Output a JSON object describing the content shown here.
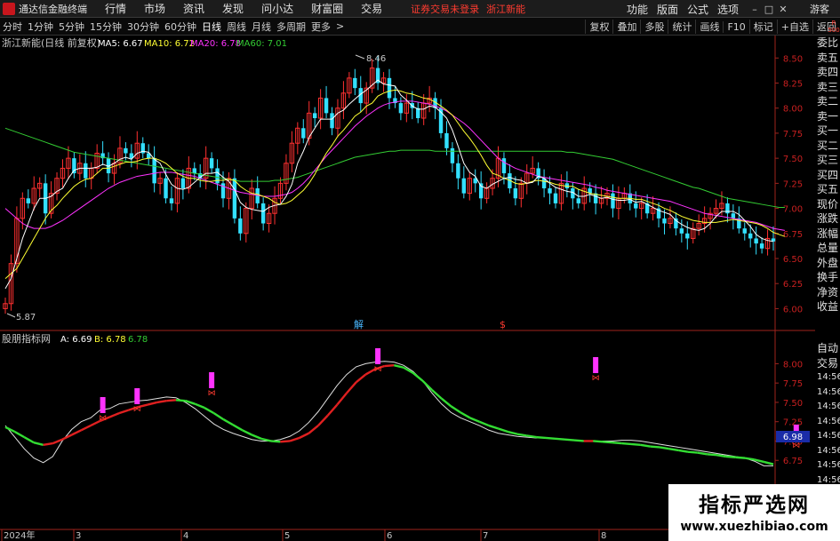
{
  "app": {
    "name": "通达信金融终端",
    "menus": [
      "行情",
      "市场",
      "资讯",
      "发现",
      "问小达",
      "财富圈",
      "交易"
    ],
    "status_text": "证券交易未登录",
    "stock_short": "浙江新能",
    "right_menus": [
      "功能",
      "版面",
      "公式",
      "选项"
    ],
    "guest": "游客"
  },
  "toolbar": {
    "periods": [
      "分时",
      "1分钟",
      "5分钟",
      "15分钟",
      "30分钟",
      "60分钟",
      "日线",
      "周线",
      "月线",
      "多周期",
      "更多"
    ],
    "active_period": "日线",
    "more_arrow": ">",
    "buttons": [
      "复权",
      "叠加",
      "多股",
      "统计",
      "画线",
      "F10",
      "标记",
      "+自选",
      "返回"
    ],
    "sell_badge": "R 500"
  },
  "main_header": {
    "title": "浙江新能(日线 前复权)",
    "ma_items": [
      {
        "label": "MA5: 6.67",
        "color": "#ffffff"
      },
      {
        "label": "MA10: 6.72",
        "color": "#ffff33"
      },
      {
        "label": "MA20: 6.78",
        "color": "#ff33ff"
      },
      {
        "label": "MA60: 7.01",
        "color": "#33cc33"
      }
    ]
  },
  "sub_header": {
    "title": "股朋指标网",
    "items": [
      {
        "label": "A: 6.69",
        "color": "#ffffff"
      },
      {
        "label": "B: 6.78",
        "color": "#ffff33"
      },
      {
        "label": "6.78",
        "color": "#33cc33"
      }
    ]
  },
  "sidebar": {
    "top_items": [
      "委比",
      "卖五",
      "卖四",
      "卖三",
      "卖二",
      "卖一",
      "买一",
      "买二",
      "买三",
      "买四",
      "买五",
      "现价",
      "涨跌",
      "涨幅",
      "总量",
      "外盘",
      "换手",
      "净资",
      "收益"
    ],
    "bottom_items": [
      "自动",
      "交易"
    ],
    "times": [
      "14:56",
      "14:56",
      "14:56",
      "14:56",
      "14:56",
      "14:56",
      "14:56",
      "14:56"
    ]
  },
  "watermark": {
    "title": "指标严选网",
    "url": "www.xuezhibiao.com"
  },
  "chart_data": {
    "type": "candlestick",
    "main_panel": {
      "ylim": [
        5.8,
        8.6
      ],
      "y_ticks": [
        "8.50",
        "8.25",
        "8.00",
        "7.75",
        "7.50",
        "7.25",
        "7.00",
        "6.75",
        "6.50",
        "6.25",
        "6.00"
      ],
      "high_annotation": "8.46",
      "low_annotation": "5.87",
      "current_price": 6.67,
      "markers": [
        "解",
        "$"
      ],
      "closes": [
        6.05,
        6.45,
        6.9,
        7.1,
        7.05,
        7.2,
        7.25,
        6.95,
        7.15,
        7.3,
        7.4,
        7.5,
        7.35,
        7.45,
        7.3,
        7.4,
        7.55,
        7.5,
        7.35,
        7.45,
        7.6,
        7.55,
        7.5,
        7.65,
        7.55,
        7.5,
        7.25,
        7.3,
        7.1,
        7.05,
        7.3,
        7.2,
        7.4,
        7.35,
        7.3,
        7.5,
        7.4,
        7.25,
        7.1,
        7.3,
        6.9,
        6.75,
        7.0,
        7.2,
        7.05,
        6.85,
        6.95,
        7.1,
        7.25,
        7.45,
        7.65,
        7.8,
        7.7,
        7.95,
        7.9,
        8.1,
        7.95,
        7.8,
        8.0,
        8.15,
        8.3,
        8.2,
        8.05,
        8.2,
        8.4,
        8.25,
        8.3,
        8.1,
        8.05,
        7.95,
        8.05,
        8.0,
        7.9,
        8.05,
        8.1,
        8.0,
        7.75,
        7.6,
        7.45,
        7.3,
        7.15,
        7.3,
        7.25,
        7.1,
        7.2,
        7.3,
        7.5,
        7.35,
        7.2,
        7.1,
        7.25,
        7.35,
        7.4,
        7.3,
        7.2,
        7.15,
        7.05,
        7.25,
        7.2,
        7.1,
        7.05,
        7.2,
        7.15,
        7.05,
        7.1,
        7.15,
        7.0,
        7.1,
        7.15,
        7.05,
        7.0,
        7.05,
        6.95,
        7.0,
        6.9,
        6.85,
        6.9,
        6.8,
        6.75,
        6.7,
        6.8,
        6.85,
        6.9,
        6.95,
        7.0,
        7.05,
        6.95,
        6.9,
        6.8,
        6.75,
        6.7,
        6.65,
        6.6,
        6.7,
        6.67
      ],
      "ma5": [
        6.2,
        6.3,
        6.5,
        6.7,
        6.85,
        7.0,
        7.1,
        7.1,
        7.12,
        7.17,
        7.2,
        7.3,
        7.38,
        7.4,
        7.4,
        7.4,
        7.41,
        7.44,
        7.42,
        7.45,
        7.49,
        7.51,
        7.49,
        7.55,
        7.57,
        7.56,
        7.49,
        7.45,
        7.34,
        7.24,
        7.2,
        7.19,
        7.21,
        7.26,
        7.31,
        7.35,
        7.35,
        7.36,
        7.31,
        7.27,
        7.19,
        7.06,
        7.01,
        6.99,
        6.98,
        6.97,
        7.01,
        7.03,
        7.04,
        7.12,
        7.24,
        7.45,
        7.57,
        7.71,
        7.8,
        7.89,
        7.89,
        7.89,
        7.95,
        7.98,
        8.04,
        8.09,
        8.14,
        8.18,
        8.23,
        8.28,
        8.24,
        8.23,
        8.22,
        8.13,
        8.08,
        8.02,
        7.99,
        7.99,
        8.02,
        8.01,
        7.96,
        7.9,
        7.78,
        7.62,
        7.45,
        7.36,
        7.32,
        7.22,
        7.2,
        7.24,
        7.27,
        7.3,
        7.31,
        7.29,
        7.28,
        7.25,
        7.26,
        7.32,
        7.3,
        7.25,
        7.21,
        7.19,
        7.17,
        7.16,
        7.12,
        7.12,
        7.14,
        7.12,
        7.1,
        7.11,
        7.09,
        7.08,
        7.08,
        7.09,
        7.06,
        7.07,
        7.04,
        7.01,
        6.98,
        6.96,
        6.94,
        6.88,
        6.84,
        6.81,
        6.79,
        6.78,
        6.8,
        6.85,
        6.92,
        6.97,
        6.97,
        6.97,
        6.94,
        6.88,
        6.82,
        6.74,
        6.7,
        6.68,
        6.67
      ],
      "ma10": [
        6.3,
        6.35,
        6.4,
        6.5,
        6.6,
        6.7,
        6.8,
        6.9,
        6.98,
        7.03,
        7.1,
        7.16,
        7.22,
        7.26,
        7.29,
        7.3,
        7.35,
        7.4,
        7.4,
        7.42,
        7.44,
        7.46,
        7.46,
        7.47,
        7.49,
        7.5,
        7.5,
        7.48,
        7.45,
        7.4,
        7.35,
        7.32,
        7.3,
        7.3,
        7.28,
        7.27,
        7.27,
        7.28,
        7.28,
        7.29,
        7.28,
        7.22,
        7.18,
        7.15,
        7.14,
        7.12,
        7.1,
        7.06,
        7.04,
        7.05,
        7.08,
        7.13,
        7.18,
        7.25,
        7.34,
        7.45,
        7.55,
        7.63,
        7.72,
        7.78,
        7.85,
        7.92,
        7.96,
        8.02,
        8.05,
        8.12,
        8.15,
        8.17,
        8.18,
        8.17,
        8.15,
        8.14,
        8.12,
        8.1,
        8.09,
        8.06,
        8.02,
        7.98,
        7.93,
        7.85,
        7.77,
        7.7,
        7.62,
        7.53,
        7.43,
        7.35,
        7.33,
        7.3,
        7.28,
        7.25,
        7.24,
        7.25,
        7.27,
        7.28,
        7.27,
        7.26,
        7.24,
        7.23,
        7.22,
        7.22,
        7.19,
        7.17,
        7.15,
        7.14,
        7.13,
        7.12,
        7.11,
        7.1,
        7.1,
        7.1,
        7.09,
        7.09,
        7.07,
        7.05,
        7.03,
        7.0,
        6.98,
        6.95,
        6.92,
        6.9,
        6.88,
        6.87,
        6.86,
        6.86,
        6.86,
        6.87,
        6.88,
        6.89,
        6.88,
        6.87,
        6.86,
        6.85,
        6.83,
        6.8,
        6.76,
        6.74,
        6.72
      ],
      "ma20": [
        7.0,
        6.95,
        6.9,
        6.85,
        6.82,
        6.8,
        6.8,
        6.8,
        6.82,
        6.85,
        6.88,
        6.92,
        6.96,
        7.0,
        7.04,
        7.08,
        7.12,
        7.16,
        7.2,
        7.23,
        7.26,
        7.28,
        7.3,
        7.32,
        7.33,
        7.34,
        7.35,
        7.36,
        7.36,
        7.36,
        7.35,
        7.34,
        7.33,
        7.32,
        7.3,
        7.28,
        7.26,
        7.24,
        7.22,
        7.2,
        7.18,
        7.16,
        7.15,
        7.14,
        7.13,
        7.12,
        7.12,
        7.12,
        7.13,
        7.14,
        7.16,
        7.2,
        7.25,
        7.31,
        7.38,
        7.45,
        7.52,
        7.58,
        7.64,
        7.7,
        7.76,
        7.82,
        7.87,
        7.92,
        7.96,
        8.0,
        8.03,
        8.05,
        8.06,
        8.07,
        8.07,
        8.07,
        8.06,
        8.05,
        8.04,
        8.02,
        8.0,
        7.97,
        7.93,
        7.89,
        7.85,
        7.8,
        7.74,
        7.68,
        7.62,
        7.56,
        7.5,
        7.46,
        7.43,
        7.4,
        7.38,
        7.36,
        7.34,
        7.32,
        7.31,
        7.3,
        7.29,
        7.28,
        7.27,
        7.26,
        7.25,
        7.24,
        7.23,
        7.21,
        7.2,
        7.18,
        7.17,
        7.16,
        7.15,
        7.14,
        7.13,
        7.12,
        7.11,
        7.1,
        7.09,
        7.08,
        7.07,
        7.05,
        7.03,
        7.01,
        6.99,
        6.97,
        6.95,
        6.94,
        6.93,
        6.92,
        6.91,
        6.9,
        6.89,
        6.88,
        6.87,
        6.86,
        6.84,
        6.82,
        6.8,
        6.79,
        6.78
      ],
      "ma60": [
        7.8,
        7.78,
        7.76,
        7.74,
        7.72,
        7.7,
        7.68,
        7.66,
        7.64,
        7.62,
        7.6,
        7.58,
        7.56,
        7.55,
        7.54,
        7.53,
        7.52,
        7.51,
        7.5,
        7.49,
        7.48,
        7.47,
        7.46,
        7.45,
        7.44,
        7.43,
        7.42,
        7.41,
        7.4,
        7.39,
        7.38,
        7.37,
        7.36,
        7.35,
        7.34,
        7.33,
        7.32,
        7.31,
        7.3,
        7.29,
        7.28,
        7.27,
        7.27,
        7.27,
        7.27,
        7.27,
        7.27,
        7.28,
        7.28,
        7.29,
        7.3,
        7.31,
        7.33,
        7.35,
        7.37,
        7.39,
        7.41,
        7.43,
        7.45,
        7.47,
        7.49,
        7.51,
        7.52,
        7.53,
        7.54,
        7.55,
        7.56,
        7.57,
        7.57,
        7.58,
        7.58,
        7.58,
        7.58,
        7.58,
        7.58,
        7.57,
        7.57,
        7.57,
        7.57,
        7.57,
        7.57,
        7.57,
        7.57,
        7.57,
        7.57,
        7.57,
        7.57,
        7.57,
        7.57,
        7.57,
        7.57,
        7.57,
        7.57,
        7.57,
        7.57,
        7.57,
        7.57,
        7.57,
        7.56,
        7.56,
        7.55,
        7.54,
        7.53,
        7.52,
        7.51,
        7.5,
        7.49,
        7.47,
        7.45,
        7.43,
        7.41,
        7.39,
        7.37,
        7.35,
        7.33,
        7.31,
        7.29,
        7.27,
        7.25,
        7.23,
        7.21,
        7.2,
        7.18,
        7.16,
        7.14,
        7.12,
        7.1,
        7.09,
        7.08,
        7.07,
        7.06,
        7.05,
        7.04,
        7.03,
        7.02,
        7.01,
        7.01
      ]
    },
    "sub_panel": {
      "ylim": [
        6.5,
        8.2
      ],
      "y_ticks": [
        "8.00",
        "7.75",
        "7.50",
        "7.25",
        "7.00",
        "6.75"
      ],
      "current_value": "6.98",
      "line_a": [
        7.2,
        7.05,
        6.9,
        6.78,
        6.72,
        6.8,
        7.0,
        7.15,
        7.25,
        7.3,
        7.4,
        7.42,
        7.48,
        7.5,
        7.52,
        7.53,
        7.55,
        7.57,
        7.56,
        7.5,
        7.42,
        7.32,
        7.22,
        7.15,
        7.1,
        7.06,
        7.02,
        7.0,
        7.0,
        7.02,
        7.06,
        7.13,
        7.24,
        7.38,
        7.55,
        7.72,
        7.86,
        7.96,
        8.0,
        8.02,
        8.03,
        8.02,
        7.98,
        7.9,
        7.78,
        7.62,
        7.48,
        7.37,
        7.3,
        7.25,
        7.2,
        7.14,
        7.1,
        7.08,
        7.06,
        7.05,
        7.04,
        7.04,
        7.03,
        7.02,
        7.01,
        7.0,
        7.0,
        7.0,
        7.0,
        7.01,
        7.01,
        7.0,
        6.98,
        6.96,
        6.94,
        6.92,
        6.9,
        6.88,
        6.86,
        6.84,
        6.82,
        6.8,
        6.78,
        6.74,
        6.68,
        6.68
      ],
      "line_b": [
        7.18,
        7.12,
        7.05,
        6.98,
        6.95,
        6.97,
        7.02,
        7.08,
        7.14,
        7.2,
        7.26,
        7.31,
        7.36,
        7.4,
        7.44,
        7.47,
        7.5,
        7.52,
        7.53,
        7.52,
        7.48,
        7.43,
        7.36,
        7.28,
        7.21,
        7.14,
        7.08,
        7.03,
        7.0,
        6.99,
        7.0,
        7.04,
        7.1,
        7.2,
        7.33,
        7.47,
        7.62,
        7.76,
        7.86,
        7.93,
        7.97,
        7.98,
        7.95,
        7.88,
        7.78,
        7.66,
        7.55,
        7.45,
        7.37,
        7.3,
        7.25,
        7.2,
        7.16,
        7.12,
        7.09,
        7.07,
        7.05,
        7.04,
        7.03,
        7.02,
        7.01,
        7.0,
        7.0,
        6.99,
        6.98,
        6.97,
        6.96,
        6.95,
        6.93,
        6.92,
        6.9,
        6.88,
        6.86,
        6.85,
        6.83,
        6.82,
        6.8,
        6.79,
        6.78,
        6.76,
        6.73,
        6.7
      ],
      "signals": [
        17,
        23,
        36,
        65,
        103,
        138,
        144,
        152
      ]
    },
    "x_date_labels": [
      "2024年",
      "3",
      "4",
      "5",
      "6",
      "7",
      "8"
    ]
  }
}
